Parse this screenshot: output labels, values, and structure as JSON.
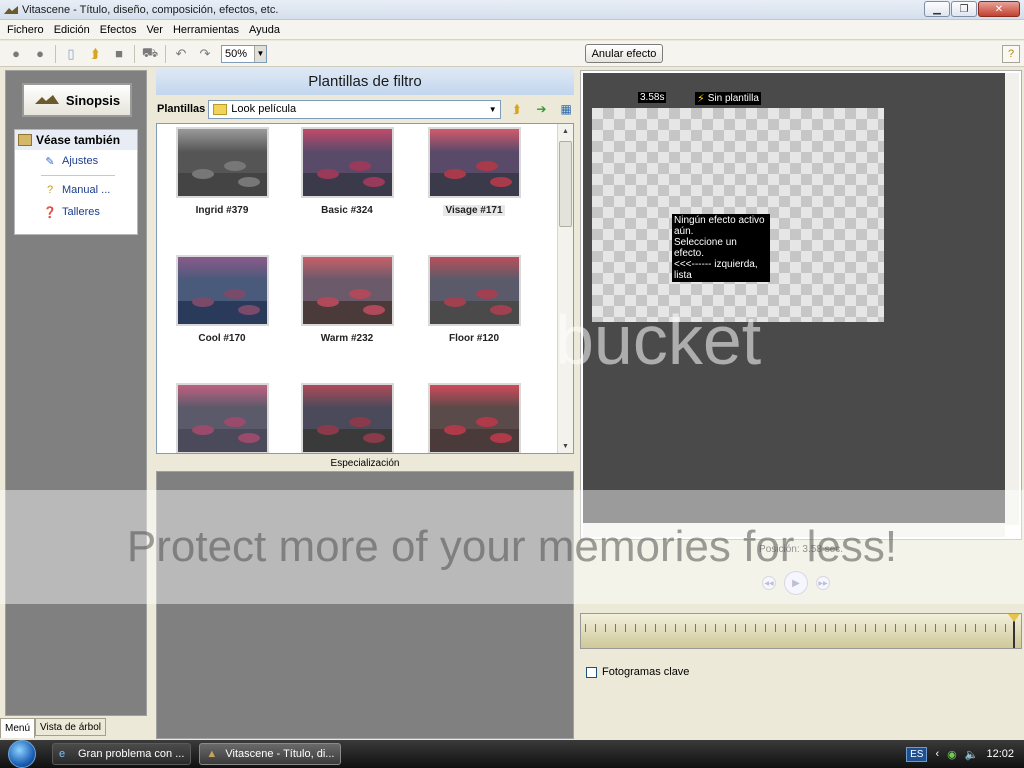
{
  "window": {
    "title": "Vitascene - Título, diseño, composición, efectos, etc."
  },
  "menu": [
    "Fichero",
    "Edición",
    "Efectos",
    "Ver",
    "Herramientas",
    "Ayuda"
  ],
  "toolbar": {
    "zoom": "50%",
    "anular": "Anular efecto"
  },
  "left": {
    "sinopsis": "Sinopsis",
    "see_also_title": "Véase también",
    "items": [
      "Ajustes",
      "Manual ...",
      "Talleres"
    ],
    "tabs": [
      "Menú",
      "Vista de árbol"
    ]
  },
  "middle": {
    "header": "Plantillas de filtro",
    "plantillas_label": "Plantillas",
    "plantillas_value": "Look película",
    "templates": [
      "Ingrid #379",
      "Basic #324",
      "Visage #171",
      "Cool #170",
      "Warm #232",
      "Floor #120",
      "",
      "",
      ""
    ],
    "especializacion": "Especialización"
  },
  "right": {
    "time": "3.58s",
    "no_template": "Sin plantilla",
    "msg1": "Ningún efecto activo aún.",
    "msg2": "Seleccione un efecto.",
    "msg3": "<<<------ izquierda, lista",
    "position": "Posición: 3.58 sec.",
    "keyframes": "Fotogramas clave"
  },
  "watermark": {
    "text": "Protect more of your memories for less!",
    "logo": "bucket"
  },
  "taskbar": {
    "tasks": [
      "Gran problema con ...",
      "Vitascene - Título, di..."
    ],
    "lang": "ES",
    "clock": "12:02"
  },
  "colors": {
    "panel_gray": "#808080",
    "preview_dark": "#4a4a4a",
    "header_blue": "#c2d6ee"
  }
}
